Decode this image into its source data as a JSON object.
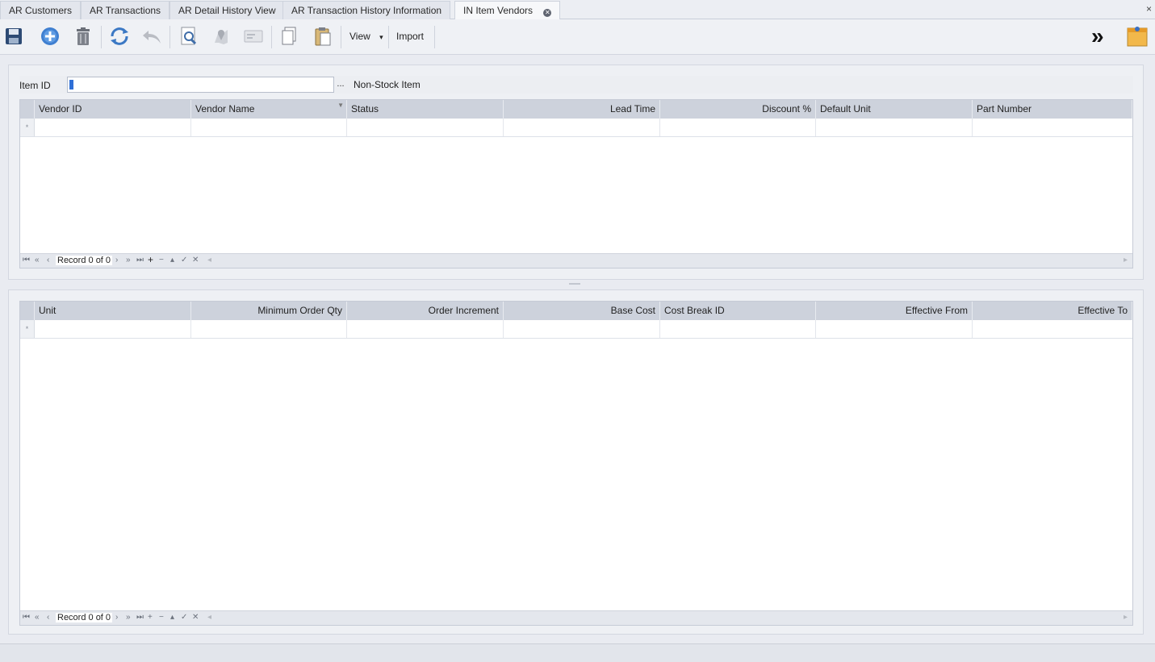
{
  "tabs": [
    {
      "label": "AR Customers"
    },
    {
      "label": "AR Transactions"
    },
    {
      "label": "AR Detail History View"
    },
    {
      "label": "AR Transaction History Information"
    },
    {
      "label": "IN Item Vendors"
    }
  ],
  "window_close": "×",
  "toolbar": {
    "icons": [
      "save-icon",
      "add-icon",
      "delete-icon",
      "refresh-icon",
      "undo-icon",
      "preview-icon",
      "map-pin-icon",
      "card-icon",
      "copy-icon",
      "paste-icon"
    ],
    "view_label": "View",
    "view_arrow": "▾",
    "import_label": "Import",
    "expand_glyph": "»"
  },
  "item": {
    "label": "Item ID",
    "value": "",
    "ellipsis": "...",
    "description": "Non-Stock Item"
  },
  "vendors_grid": {
    "columns": [
      "Vendor ID",
      "Vendor Name",
      "Status",
      "Lead Time",
      "Discount %",
      "Default Unit",
      "Part Number"
    ],
    "new_row_marker": "*",
    "record_text": "Record 0 of 0"
  },
  "price_grid": {
    "columns": [
      "Unit",
      "Minimum Order Qty",
      "Order Increment",
      "Base Cost",
      "Cost Break ID",
      "Effective From",
      "Effective To"
    ],
    "new_row_marker": "*",
    "record_text": "Record 0 of 0"
  },
  "nav_glyphs": [
    "⏮",
    "«",
    "‹",
    "›",
    "»",
    "⏭",
    "+",
    "−",
    "▴",
    "✓",
    "✕",
    "◂"
  ],
  "colors": {
    "header_bg": "#cdd2dc",
    "accent": "#2f6fd6",
    "panel_bg": "#eef0f4"
  }
}
